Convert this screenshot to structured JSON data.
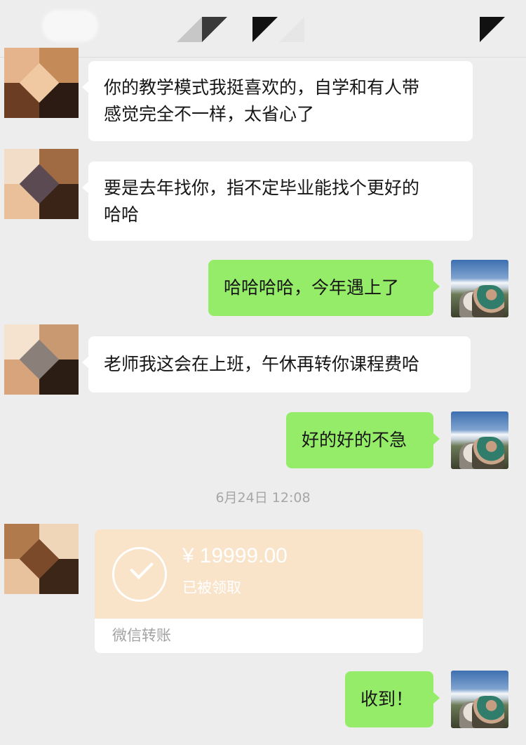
{
  "messages": [
    {
      "from": "other",
      "text": "你的教学模式我挺喜欢的，自学和有人带\n感觉完全不一样，太省心了"
    },
    {
      "from": "other",
      "text": "要是去年找你，指不定毕业能找个更好的\n哈哈"
    },
    {
      "from": "me",
      "text": "哈哈哈哈，今年遇上了"
    },
    {
      "from": "other",
      "text": "老师我这会在上班，午休再转你课程费哈"
    },
    {
      "from": "me",
      "text": "好的好的不急"
    },
    {
      "from": "me",
      "text": "收到！"
    }
  ],
  "timestamp": "6月24日 12:08",
  "transfer": {
    "currency": "¥",
    "amount": "19999.00",
    "status": "已被领取",
    "label": "微信转账",
    "icon": "check-circle-icon"
  },
  "colors": {
    "background": "#ededed",
    "incoming_bubble": "#ffffff",
    "outgoing_bubble": "#95ec69",
    "transfer_card": "#f9e3c9"
  }
}
